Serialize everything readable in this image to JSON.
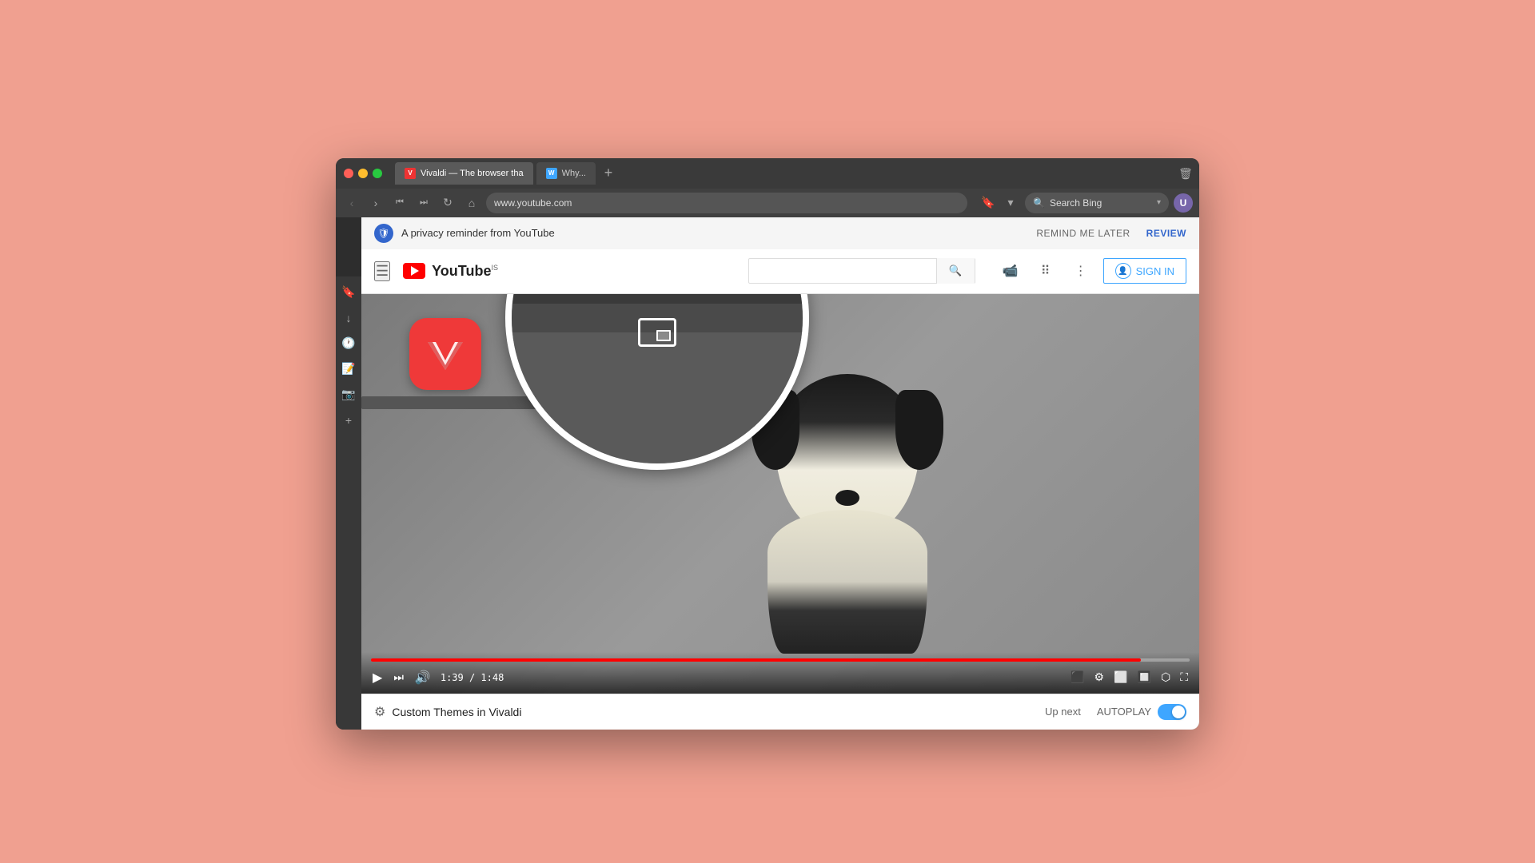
{
  "window": {
    "title": "Vivaldi — The browser that...",
    "tab1_label": "Vivaldi — The browser tha",
    "tab2_label": "Why...",
    "address": "www.youtube.com",
    "search_placeholder": "Search Bing",
    "search_value": "Search Bing"
  },
  "privacy_banner": {
    "text": "A privacy reminder from YouTube",
    "remind_later": "REMIND ME LATER",
    "review": "REVIEW"
  },
  "youtube": {
    "logo_text": "YouTube",
    "logo_sup": "IS",
    "sign_in": "SIGN IN",
    "search_placeholder": ""
  },
  "video": {
    "title": "Custom Themes in Vivaldi",
    "time_current": "1:39",
    "time_total": "1:48",
    "time_display": "1:39 / 1:48",
    "progress_percent": 94,
    "up_next": "Up next",
    "autoplay": "AUTOPLAY"
  },
  "magnifier": {
    "pip_label": "Picture-in-picture icon"
  },
  "sidebar": {
    "icons": [
      "bookmark",
      "download",
      "history",
      "notes",
      "snapshot",
      "add"
    ]
  }
}
